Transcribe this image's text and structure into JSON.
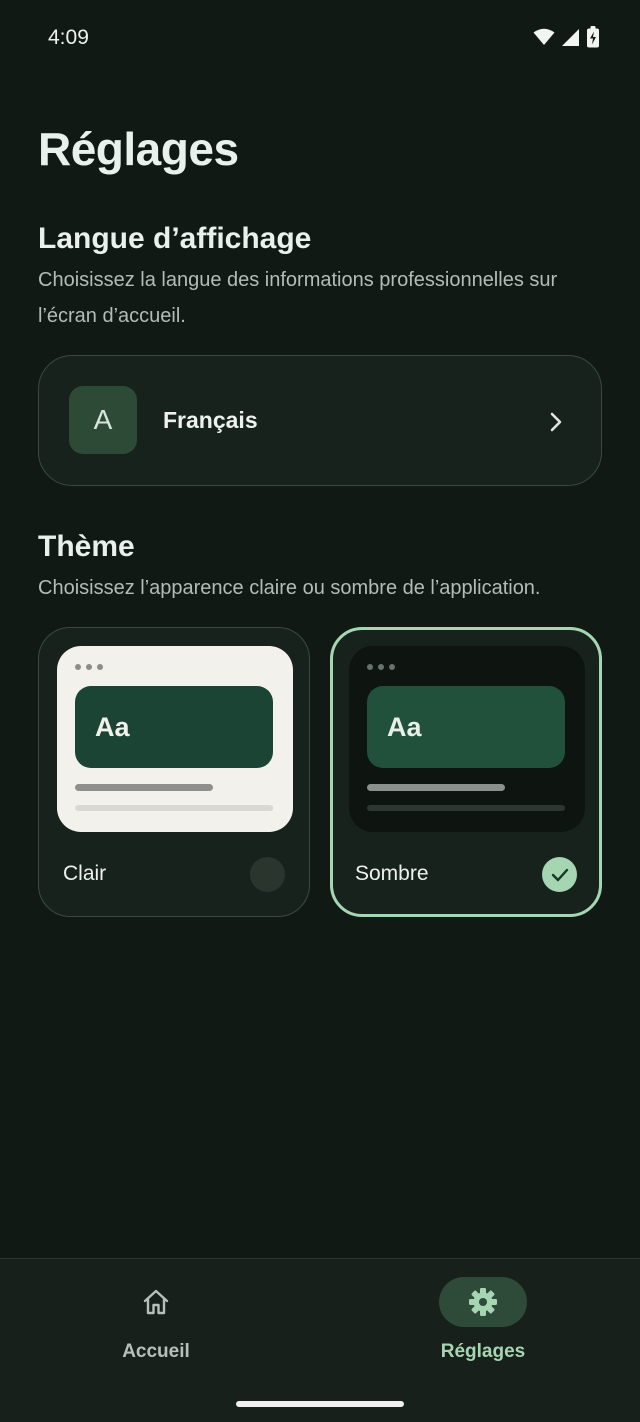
{
  "status_bar": {
    "time": "4:09",
    "icons": [
      "wifi-icon",
      "cell-signal-icon",
      "battery-charging-icon"
    ]
  },
  "page": {
    "title": "Réglages"
  },
  "language_section": {
    "title": "Langue d’affichage",
    "description": "Choisissez la langue des informations professionnelles sur l’écran d’accueil.",
    "selected": {
      "avatar_letter": "A",
      "name": "Français",
      "icon": "chevron-right-icon"
    }
  },
  "theme_section": {
    "title": "Thème",
    "description": "Choisissez l’apparence claire ou sombre de l’application.",
    "options": [
      {
        "label": "Clair",
        "preview_text": "Aa",
        "selected": false
      },
      {
        "label": "Sombre",
        "preview_text": "Aa",
        "selected": true
      }
    ]
  },
  "bottom_nav": {
    "items": [
      {
        "label": "Accueil",
        "icon": "home-icon",
        "active": false
      },
      {
        "label": "Réglages",
        "icon": "gear-icon",
        "active": true
      }
    ]
  },
  "colors": {
    "background": "#101914",
    "accent": "#a6d5b2",
    "card": "#18221c"
  }
}
